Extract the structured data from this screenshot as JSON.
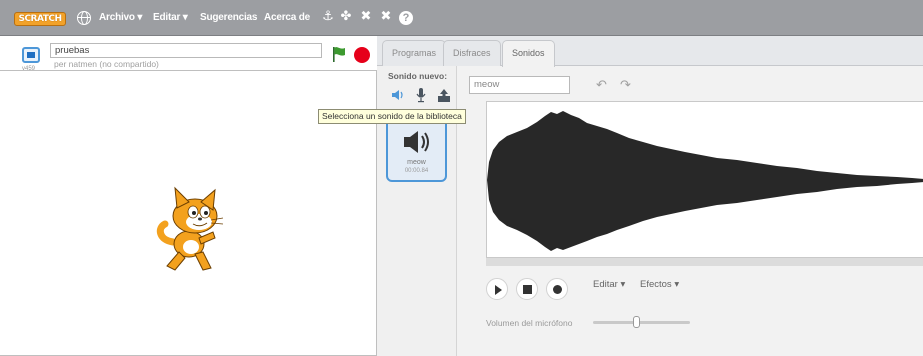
{
  "menubar": {
    "logo_text": "SCRATCH",
    "items": [
      "Archivo ▾",
      "Editar ▾",
      "Sugerencias",
      "Acerca de"
    ],
    "tools": [
      "duplicate-stamp-icon",
      "delete-scissors-icon",
      "grow-icon",
      "shrink-icon",
      "help-icon"
    ],
    "help_glyph": "?"
  },
  "project": {
    "title": "pruebas",
    "byline": "per natmen (no compartido)",
    "version": "v459"
  },
  "tabs": [
    "Programas",
    "Disfraces",
    "Sonidos"
  ],
  "active_tab": "Sonidos",
  "sounds_panel": {
    "new_sound_label": "Sonido nuevo:",
    "tooltip": "Selecciona un sonido de la biblioteca",
    "items": [
      {
        "name": "meow",
        "duration": "00:00.84"
      }
    ]
  },
  "editor": {
    "sound_name": "meow",
    "edit_menu": "Editar ▾",
    "effects_menu": "Efectos ▾",
    "mic_volume_label": "Volumen del micrófono",
    "mic_volume_level": 0.45
  },
  "colors": {
    "menubar": "#9c9ea2",
    "accent_blue": "#4d97d8",
    "green_flag": "#2e8b2e",
    "stop_red": "#e6001a",
    "waveform": "#282828"
  }
}
